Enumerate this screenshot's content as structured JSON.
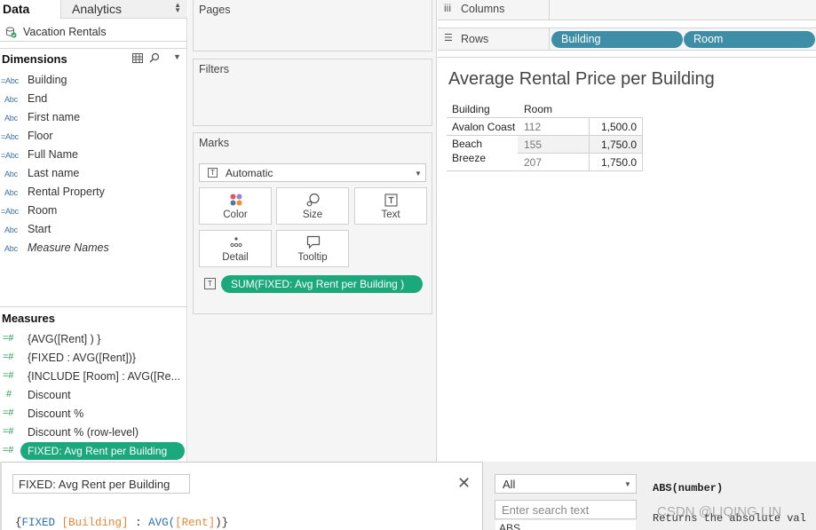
{
  "data_pane": {
    "tab_data": "Data",
    "tab_analytics": "Analytics",
    "datasource_name": "Vacation Rentals",
    "dimensions_title": "Dimensions",
    "dimensions": [
      {
        "type": "=Abc",
        "name": "Building",
        "italic": false
      },
      {
        "type": "Abc",
        "name": "End",
        "italic": false
      },
      {
        "type": "Abc",
        "name": "First name",
        "italic": false
      },
      {
        "type": "=Abc",
        "name": "Floor",
        "italic": false
      },
      {
        "type": "=Abc",
        "name": "Full Name",
        "italic": false
      },
      {
        "type": "Abc",
        "name": "Last name",
        "italic": false
      },
      {
        "type": "Abc",
        "name": "Rental Property",
        "italic": false
      },
      {
        "type": "=Abc",
        "name": "Room",
        "italic": false
      },
      {
        "type": "Abc",
        "name": "Start",
        "italic": false
      },
      {
        "type": "Abc",
        "name": "Measure Names",
        "italic": true
      }
    ],
    "measures_title": "Measures",
    "measures": [
      {
        "type": "=#",
        "name": "{AVG([Rent] ) }"
      },
      {
        "type": "=#",
        "name": "{FIXED : AVG([Rent])}"
      },
      {
        "type": "=#",
        "name": "{INCLUDE [Room] : AVG([Re..."
      },
      {
        "type": "#",
        "name": "Discount"
      },
      {
        "type": "=#",
        "name": "Discount %"
      },
      {
        "type": "=#",
        "name": "Discount % (row-level)"
      }
    ],
    "selected_measure": {
      "type": "=#",
      "name": "FIXED: Avg Rent per Building"
    }
  },
  "cards": {
    "pages_title": "Pages",
    "filters_title": "Filters",
    "marks_title": "Marks",
    "mark_type": "Automatic",
    "mark_type_icon": "T",
    "mark_buttons": [
      {
        "label": "Color",
        "icon": "color-dots-icon"
      },
      {
        "label": "Size",
        "icon": "size-icon"
      },
      {
        "label": "Text",
        "icon": "text-icon"
      },
      {
        "label": "Detail",
        "icon": "detail-icon"
      },
      {
        "label": "Tooltip",
        "icon": "tooltip-icon"
      }
    ],
    "mark_field_icon": "T",
    "mark_field_pill": "SUM(FIXED: Avg Rent per Building  )"
  },
  "shelves": {
    "columns_label": "Columns",
    "rows_label": "Rows",
    "rows_pills": [
      "Building",
      "Room"
    ]
  },
  "view": {
    "title": "Average Rental Price per Building",
    "headers": [
      "Building",
      "Room"
    ],
    "rows": [
      {
        "building": "Avalon Coast",
        "room": "112",
        "value": "1,500.0"
      },
      {
        "building": "Beach\nBreeze",
        "room": "155",
        "value": "1,750.0"
      },
      {
        "building": "",
        "room": "207",
        "value": "1,750.0"
      }
    ],
    "beach_line1": "Beach",
    "beach_line2": "Breeze"
  },
  "calc_editor": {
    "name": "FIXED: Avg Rent per Building",
    "formula": {
      "open": "{",
      "keyword": "FIXED",
      "dimension": "[Building]",
      "colon": ":",
      "func": "AVG(",
      "measure": "[Rent]",
      "close": ")}"
    },
    "function_category": "All",
    "search_placeholder": "Enter search text",
    "function_list_item": "ABS",
    "function_signature": "ABS(number)",
    "function_description": "Returns the absolute val"
  },
  "watermark": "CSDN @LIQING LIN",
  "colors": {
    "measure_pill": "#1ba97b",
    "dimension_pill": "#3e8ea8",
    "formula_keyword": "#2f6fb3",
    "formula_field": "#e8873a"
  }
}
